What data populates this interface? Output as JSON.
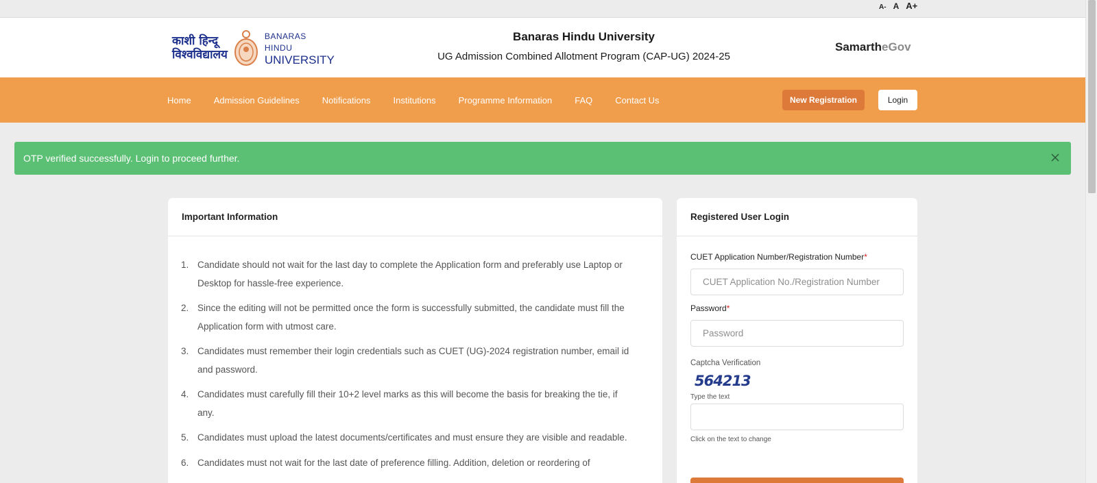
{
  "font_controls": {
    "small": "A-",
    "normal": "A",
    "large": "A+"
  },
  "logo": {
    "hindi_line1": "काशी हिन्दू",
    "hindi_line2": "विश्वविद्यालय",
    "english_line1": "BANARAS HINDU",
    "english_line2": "UNIVERSITY"
  },
  "header": {
    "title": "Banaras Hindu University",
    "subtitle": "UG Admission Combined Allotment Program (CAP-UG) 2024-25",
    "brand_main": "Samarth",
    "brand_sub": "eGov"
  },
  "nav": {
    "items": [
      {
        "label": "Home"
      },
      {
        "label": "Admission Guidelines"
      },
      {
        "label": "Notifications"
      },
      {
        "label": "Institutions"
      },
      {
        "label": "Programme Information"
      },
      {
        "label": "FAQ"
      },
      {
        "label": "Contact Us"
      }
    ],
    "new_registration": "New Registration",
    "login": "Login"
  },
  "alert": {
    "message": "OTP verified successfully. Login to proceed further."
  },
  "info": {
    "title": "Important Information",
    "items": [
      {
        "num": "1.",
        "text": "Candidate should not wait for the last day to complete the Application form and preferably use Laptop or Desktop for hassle-free experience."
      },
      {
        "num": "2.",
        "text": "Since the editing will not be permitted once the form is successfully submitted, the candidate must fill the Application form with utmost care."
      },
      {
        "num": "3.",
        "text": "Candidates must remember their login credentials such as CUET (UG)-2024 registration number, email id and password."
      },
      {
        "num": "4.",
        "text": "Candidates must carefully fill their 10+2 level marks as this will become the basis for breaking the tie, if any."
      },
      {
        "num": "5.",
        "text": "Candidates must upload the latest documents/certificates and must ensure they are visible and readable."
      },
      {
        "num": "6.",
        "text": "Candidates must not wait for the last date of preference filling. Addition, deletion or reordering of"
      }
    ]
  },
  "login": {
    "title": "Registered User Login",
    "app_no_label": "CUET Application Number/Registration Number",
    "required_mark": "*",
    "app_no_placeholder": "CUET Application No./Registration Number",
    "password_label": "Password",
    "password_placeholder": "Password",
    "captcha_label": "Captcha Verification",
    "captcha_text": "564213",
    "type_text": "Type the text",
    "captcha_hint": "Click on the text to change"
  },
  "colors": {
    "nav_bg": "#f09d4c",
    "accent_button": "#dd7a3a",
    "alert_bg": "#5bbf74",
    "brand_blue": "#1c2f8c"
  }
}
